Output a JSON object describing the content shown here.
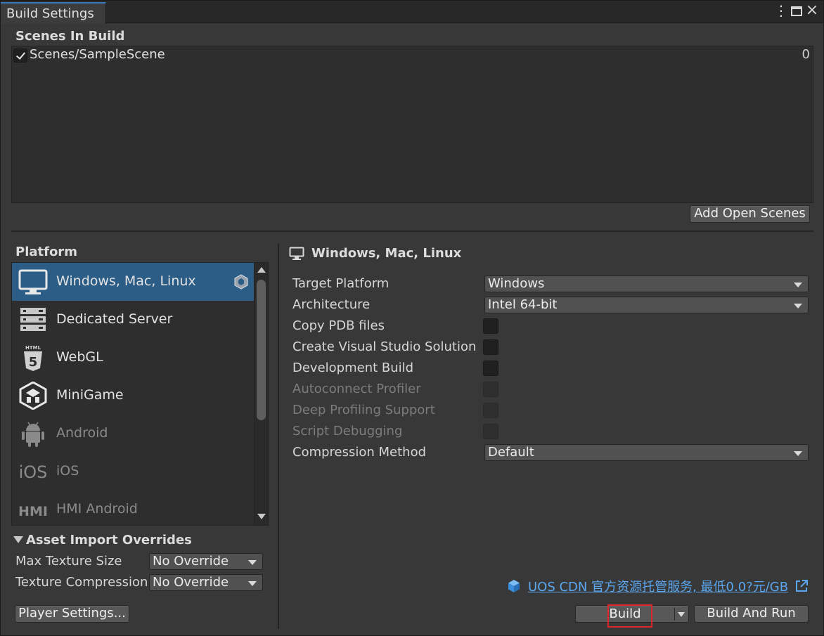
{
  "window": {
    "tab_title": "Build Settings",
    "menu_glyph": "⋮",
    "close_glyph": "×"
  },
  "scenes": {
    "title": "Scenes In Build",
    "items": [
      {
        "name": "Scenes/SampleScene",
        "index": "0",
        "checked": true
      }
    ],
    "add_open_scenes_label": "Add Open Scenes"
  },
  "platform": {
    "title": "Platform",
    "items": [
      {
        "label": "Windows, Mac, Linux",
        "icon": "monitor-icon",
        "selected": true,
        "enabled": true
      },
      {
        "label": "Dedicated Server",
        "icon": "server-icon",
        "selected": false,
        "enabled": true
      },
      {
        "label": "WebGL",
        "icon": "html5-icon",
        "selected": false,
        "enabled": true
      },
      {
        "label": "MiniGame",
        "icon": "minigame-icon",
        "selected": false,
        "enabled": true
      },
      {
        "label": "Android",
        "icon": "android-icon",
        "selected": false,
        "enabled": false
      },
      {
        "label": "iOS",
        "icon": "ios-icon",
        "selected": false,
        "enabled": false
      },
      {
        "label": "HMI Android",
        "icon": "hmi-icon",
        "selected": false,
        "enabled": false
      }
    ],
    "ios_icon_text": "iOS",
    "hmi_icon_text": "HMI",
    "html5_icon_text": "HTML"
  },
  "asset_import": {
    "title": "Asset Import Overrides",
    "max_texture_size_label": "Max Texture Size",
    "max_texture_size_value": "No Override",
    "texture_compression_label": "Texture Compression",
    "texture_compression_value": "No Override"
  },
  "player_settings_label": "Player Settings...",
  "settings": {
    "header": "Windows, Mac, Linux",
    "target_platform_label": "Target Platform",
    "target_platform_value": "Windows",
    "architecture_label": "Architecture",
    "architecture_value": "Intel 64-bit",
    "copy_pdb_label": "Copy PDB files",
    "copy_pdb_checked": false,
    "create_vs_label": "Create Visual Studio Solution",
    "create_vs_checked": false,
    "dev_build_label": "Development Build",
    "dev_build_checked": false,
    "autoconnect_label": "Autoconnect Profiler",
    "deep_profiling_label": "Deep Profiling Support",
    "script_debugging_label": "Script Debugging",
    "compression_label": "Compression Method",
    "compression_value": "Default"
  },
  "cdn_link_text": "UOS CDN 官方资源托管服务, 最低0.0?元/GB",
  "build_label": "Build",
  "build_and_run_label": "Build And Run",
  "colors": {
    "accent_selected": "#2c5d87",
    "link": "#5aa7f0",
    "highlight": "#e0262b"
  }
}
